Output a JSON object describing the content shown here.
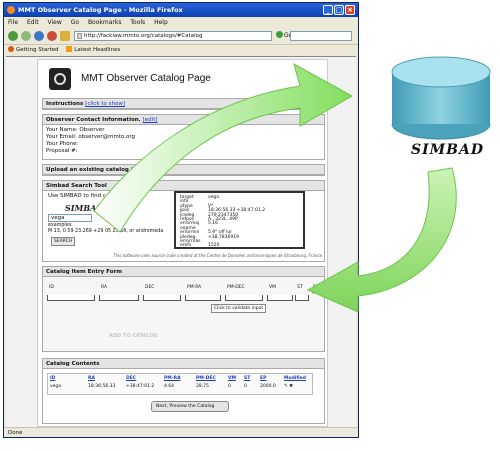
{
  "window": {
    "title": "MMT Observer Catalog Page - Mozilla Firefox",
    "menu": [
      "File",
      "Edit",
      "View",
      "Go",
      "Bookmarks",
      "Tools",
      "Help"
    ],
    "url": "http://fackiaw.mmto.org/catalogs/#Catalog",
    "go_label": "Go",
    "bookmarks": [
      "Getting Started",
      "Latest Headlines"
    ],
    "status": "Done"
  },
  "page": {
    "title": "MMT Observer Catalog Page",
    "instructions": {
      "heading": "Instructions",
      "link": "[click to show]"
    },
    "contact": {
      "heading": "Observer Contact Information.",
      "edit_link": "[edit]",
      "lines": [
        "Your Name: Observer",
        "Your Email: observer@mmto.org",
        "Your Phone:",
        "Proposal #:"
      ]
    },
    "upload": {
      "heading": "Upload an existing catalog",
      "link": "[cl"
    },
    "simbad": {
      "heading": "Simbad Search Tool",
      "intro": "Use SIMBAD to find c",
      "logo_text": "SIMBAD",
      "query": "vega",
      "examples_label": "examples:",
      "examples": "M 13, 0 59 23.269 +29 05 25.56, or andromeda",
      "search_button": "SEARCH",
      "result_keys": [
        "target",
        "info",
        "otype",
        "jpos",
        "jradeg",
        "refpos",
        "errormaj",
        "oopme",
        "errormin",
        "jdedeg",
        "errorrnas",
        "erefs"
      ],
      "result_values": [
        "vega",
        "",
        "V*",
        "18:36:56.33 +38:47:01.2",
        "279.2347350",
        "A...323L..49P",
        "5.16",
        "",
        "5.9° off lur",
        "+38.7836919",
        "",
        "1520"
      ],
      "credit": "This software uses source code created at the Centre de Données astronomiques de Strasbourg, France."
    },
    "entry": {
      "heading": "Catalog Item Entry Form",
      "columns": [
        "ID",
        "RA",
        "DEC",
        "PM-RA",
        "PM-DEC",
        "VM",
        "ST",
        "EP"
      ],
      "validate": "Click to validate input",
      "add_button": "ADD TO CATALOG"
    },
    "contents": {
      "heading": "Catalog Contents",
      "columns": [
        "ID",
        "RA",
        "DEC",
        "PM-RA",
        "PM-DEC",
        "VM",
        "ST",
        "EP",
        "Modified"
      ],
      "row": [
        "vega",
        "18:36:56.33",
        "+38:47:01.2",
        "4.64",
        "28.75",
        "0",
        "0",
        "2000.0",
        "✎ ✖"
      ],
      "next_button": "Next, Preview the Catalog"
    }
  },
  "database": {
    "label": "SIMBAD",
    "color": "#5fb2c6"
  },
  "arrows": {
    "color": "#8ee36a"
  }
}
